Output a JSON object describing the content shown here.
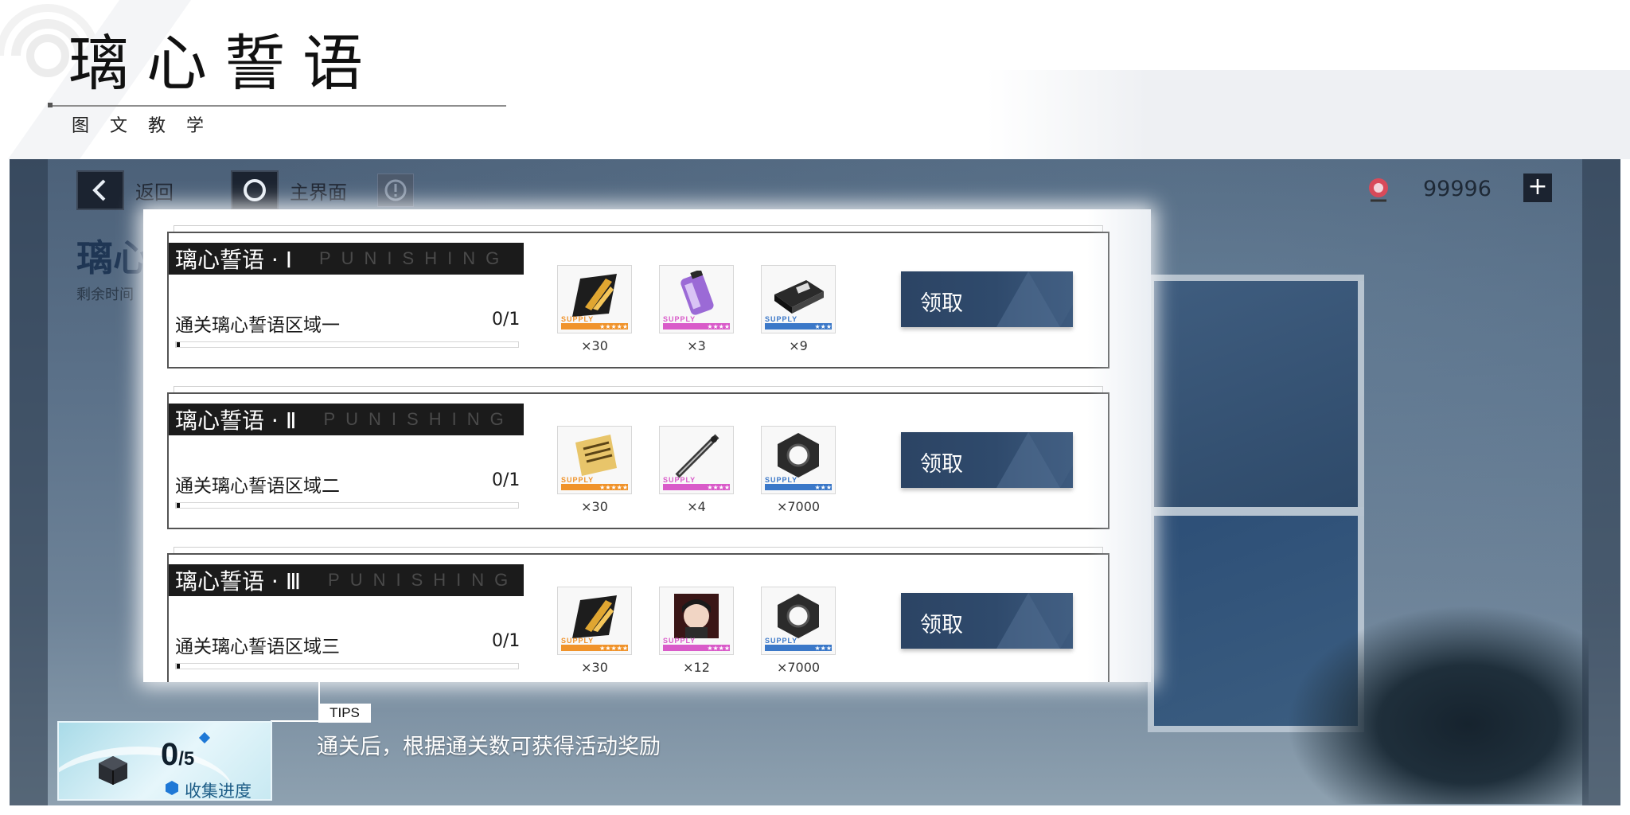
{
  "doc": {
    "title": "璃心誓语",
    "subtitle": "图文教学"
  },
  "nav": {
    "back_label": "返回",
    "home_label": "主界面",
    "currency_value": "99996",
    "currency_add": "+"
  },
  "background": {
    "event_title": "璃心",
    "event_time": "剩余时间"
  },
  "rewards": [
    {
      "name": "璃心誓语 · Ⅰ",
      "brand": "PUNISHING",
      "task": "通关璃心誓语区域一",
      "progress": "0/1",
      "progress_value": 0,
      "claim_label": "领取",
      "items": [
        {
          "icon": "gold-ticket-icon",
          "supply": "SUPPLY",
          "rarity_color": "#f0932b",
          "stars": "★★★★★",
          "count": "×30"
        },
        {
          "icon": "purple-canister-icon",
          "supply": "SUPPLY",
          "rarity_color": "#d95bc9",
          "stars": "★★★★",
          "count": "×3"
        },
        {
          "icon": "data-chip-icon",
          "supply": "SUPPLY",
          "rarity_color": "#3b78c8",
          "stars": "★★★",
          "count": "×9"
        }
      ]
    },
    {
      "name": "璃心誓语 · Ⅱ",
      "brand": "PUNISHING",
      "task": "通关璃心誓语区域二",
      "progress": "0/1",
      "progress_value": 0,
      "claim_label": "领取",
      "items": [
        {
          "icon": "gold-document-icon",
          "supply": "SUPPLY",
          "rarity_color": "#f0932b",
          "stars": "★★★★★",
          "count": "×30"
        },
        {
          "icon": "blade-icon",
          "supply": "SUPPLY",
          "rarity_color": "#d95bc9",
          "stars": "★★★★",
          "count": "×4"
        },
        {
          "icon": "hex-nut-icon",
          "supply": "SUPPLY",
          "rarity_color": "#3b78c8",
          "stars": "★★★",
          "count": "×7000"
        }
      ]
    },
    {
      "name": "璃心誓语 · Ⅲ",
      "brand": "PUNISHING",
      "task": "通关璃心誓语区域三",
      "progress": "0/1",
      "progress_value": 0,
      "claim_label": "领取",
      "items": [
        {
          "icon": "gold-ticket-icon",
          "supply": "SUPPLY",
          "rarity_color": "#f0932b",
          "stars": "★★★★★",
          "count": "×30"
        },
        {
          "icon": "character-portrait-icon",
          "supply": "SUPPLY",
          "rarity_color": "#d95bc9",
          "stars": "★★★★",
          "count": "×12"
        },
        {
          "icon": "hex-nut-icon",
          "supply": "SUPPLY",
          "rarity_color": "#3b78c8",
          "stars": "★★★",
          "count": "×7000"
        }
      ]
    }
  ],
  "tips": {
    "tag": "TIPS",
    "text": "通关后，根据通关数可获得活动奖励"
  },
  "collection": {
    "value": "0",
    "total": "/5",
    "label": "收集进度"
  },
  "colors": {
    "claim_button": "#2f4a6c",
    "header_bar": "#1b1b1b",
    "scene_bg": "#5b7189"
  }
}
